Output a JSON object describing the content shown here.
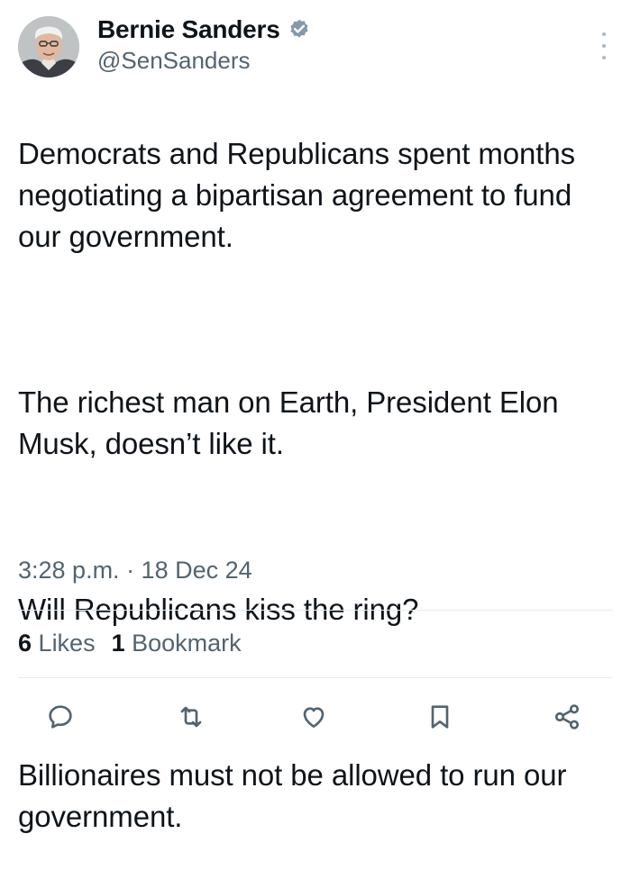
{
  "author": {
    "display_name": "Bernie Sanders",
    "handle": "@SenSanders",
    "verified": true
  },
  "tweet": {
    "paragraphs": [
      "Democrats and Republicans spent months negotiating a bipartisan agreement to fund our government.",
      "The richest man on Earth, President Elon Musk, doesn’t like it.",
      "Will Republicans kiss the ring?",
      "Billionaires must not be allowed to run our government."
    ]
  },
  "timestamp": "3:28 p.m. · 18 Dec 24",
  "stats": {
    "likes_count": "6",
    "likes_label": "Likes",
    "bookmarks_count": "1",
    "bookmarks_label": "Bookmark"
  },
  "actions": [
    "reply-icon",
    "retweet-icon",
    "like-icon",
    "bookmark-icon",
    "share-icon"
  ],
  "colors": {
    "text": "#0f1419",
    "secondary": "#536471",
    "verified": "#829aab",
    "divider": "#e6ecf0"
  }
}
